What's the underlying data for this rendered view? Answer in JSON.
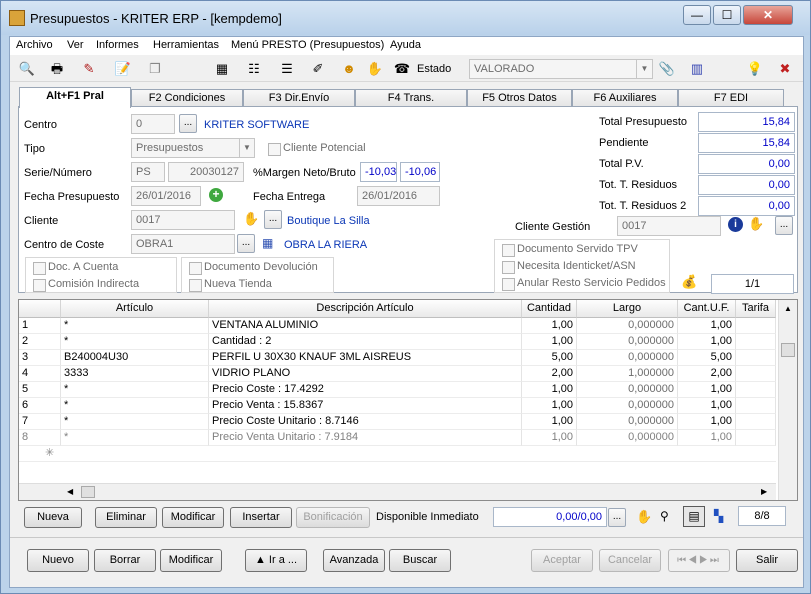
{
  "window": {
    "title": "Presupuestos - KRITER ERP - [kempdemo]",
    "min": "—",
    "max": "☐",
    "close": "✕"
  },
  "menu": [
    "Archivo",
    "Ver",
    "Informes",
    "Herramientas",
    "Menú PRESTO (Presupuestos)",
    "Ayuda"
  ],
  "toolbar": {
    "estado_label": "Estado",
    "estado_value": "VALORADO"
  },
  "tabs": [
    "Alt+F1 Pral",
    "F2 Condiciones",
    "F3 Dir.Envío",
    "F4 Trans.",
    "F5 Otros Datos",
    "F6 Auxiliares",
    "F7 EDI"
  ],
  "form": {
    "centro_label": "Centro",
    "centro_value": "0",
    "centro_name": "KRITER SOFTWARE",
    "tipo_label": "Tipo",
    "tipo_value": "Presupuestos",
    "cliente_potencial": "Cliente Potencial",
    "serie_label": "Serie/Número",
    "serie_value": "PS",
    "numero_value": "20030127",
    "margen_label": "%Margen Neto/Bruto",
    "margen_neto": "-10,03",
    "margen_bruto": "-10,06",
    "fecha_pres_label": "Fecha Presupuesto",
    "fecha_pres_value": "26/01/2016",
    "fecha_ent_label": "Fecha Entrega",
    "fecha_ent_value": "26/01/2016",
    "cliente_label": "Cliente",
    "cliente_value": "0017",
    "cliente_name": "Boutique La Silla",
    "coste_label": "Centro de Coste",
    "coste_value": "OBRA1",
    "coste_name": "OBRA LA RIERA",
    "gestion_label": "Cliente Gestión",
    "gestion_value": "0017",
    "checks_left": [
      "Doc. A Cuenta",
      "Comisión Indirecta"
    ],
    "checks_mid": [
      "Documento Devolución",
      "Nueva Tienda"
    ],
    "checks_right": [
      "Documento Servido TPV",
      "Necesita Identicket/ASN",
      "Anular Resto Servicio Pedidos"
    ],
    "page_indicator": "1/1"
  },
  "totals": [
    {
      "label": "Total Presupuesto",
      "value": "15,84",
      "color": "#0000c8"
    },
    {
      "label": "Pendiente",
      "value": "15,84",
      "color": "#0000c8"
    },
    {
      "label": "Total P.V.",
      "value": "0,00",
      "color": "#0000c8"
    },
    {
      "label": "Tot. T. Residuos",
      "value": "0,00",
      "color": "#0000c8"
    },
    {
      "label": "Tot. T. Residuos 2",
      "value": "0,00",
      "color": "#0000c8"
    }
  ],
  "grid": {
    "headers": [
      "Artículo",
      "Descripción Artículo",
      "Cantidad",
      "Largo",
      "Cant.U.F.",
      "Tarifa"
    ],
    "rows": [
      {
        "n": "1",
        "art": "*",
        "desc": "VENTANA ALUMINIO",
        "cant": "1,00",
        "largo": "0,000000",
        "cuf": "1,00"
      },
      {
        "n": "2",
        "art": "*",
        "desc": "Cantidad  : 2",
        "cant": "1,00",
        "largo": "0,000000",
        "cuf": "1,00"
      },
      {
        "n": "3",
        "art": "B240004U30",
        "desc": "PERFIL U 30X30 KNAUF 3ML AISREUS",
        "cant": "5,00",
        "largo": "0,000000",
        "cuf": "5,00"
      },
      {
        "n": "4",
        "art": "3333",
        "desc": "VIDRIO PLANO",
        "cant": "2,00",
        "largo": "1,000000",
        "cuf": "2,00"
      },
      {
        "n": "5",
        "art": "*",
        "desc": "Precio Coste : 17.4292",
        "cant": "1,00",
        "largo": "0,000000",
        "cuf": "1,00"
      },
      {
        "n": "6",
        "art": "*",
        "desc": "Precio Venta : 15.8367",
        "cant": "1,00",
        "largo": "0,000000",
        "cuf": "1,00"
      },
      {
        "n": "7",
        "art": "*",
        "desc": "Precio Coste Unitario : 8.7146",
        "cant": "1,00",
        "largo": "0,000000",
        "cuf": "1,00"
      },
      {
        "n": "8",
        "art": "*",
        "desc": "Precio Venta Unitario : 7.9184",
        "cant": "1,00",
        "largo": "0,000000",
        "cuf": "1,00"
      }
    ],
    "new_row_marker": "✳"
  },
  "line_buttons": {
    "nueva": "Nueva",
    "eliminar": "Eliminar",
    "modificar": "Modificar",
    "insertar": "Insertar",
    "bonificacion": "Bonificación",
    "disponible_label": "Disponible Inmediato",
    "disponible_value": "0,00/0,00",
    "count": "8/8"
  },
  "bottom_buttons": {
    "nuevo": "Nuevo",
    "borrar": "Borrar",
    "modificar": "Modificar",
    "ira": "▲ Ir a ...",
    "avanzada": "Avanzada",
    "buscar": "Buscar",
    "aceptar": "Aceptar",
    "cancelar": "Cancelar",
    "salir": "Salir"
  }
}
